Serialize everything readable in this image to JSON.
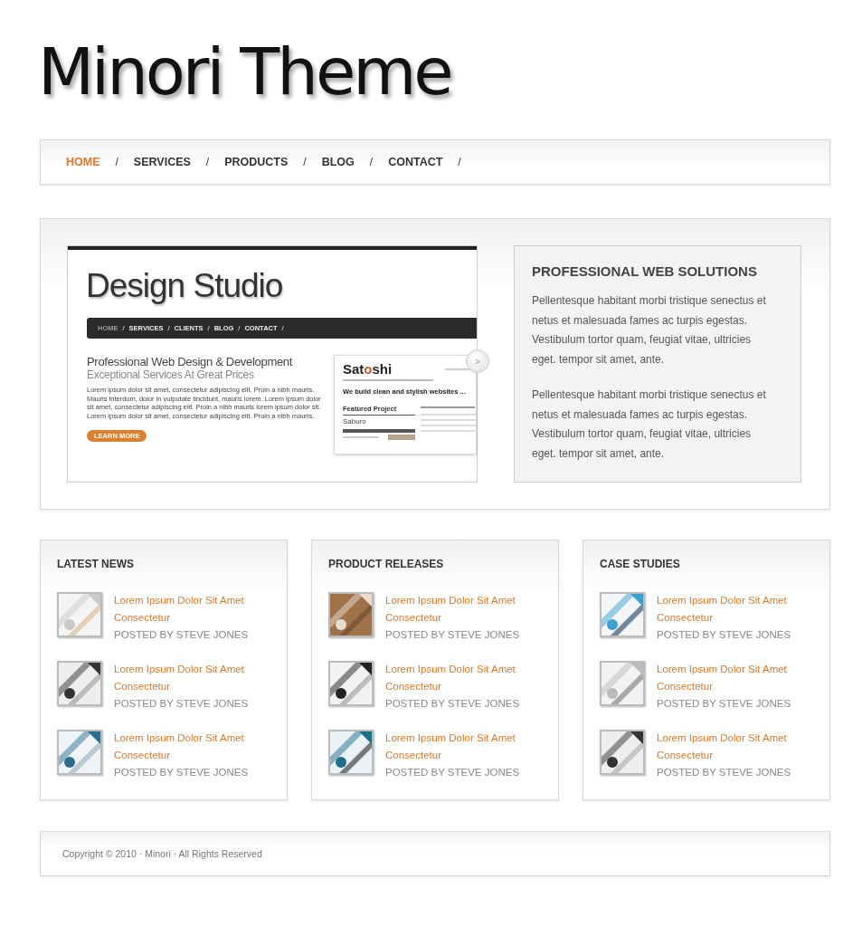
{
  "site_title": "Minori Theme",
  "nav": [
    {
      "label": "HOME",
      "selected": true,
      "separator": "/"
    },
    {
      "label": "SERVICES",
      "selected": false,
      "separator": "/"
    },
    {
      "label": "PRODUCTS",
      "selected": false,
      "separator": "/"
    },
    {
      "label": "BLOG",
      "selected": false,
      "separator": "/"
    },
    {
      "label": "CONTACT",
      "selected": false,
      "separator": "/"
    }
  ],
  "slider": {
    "slide": {
      "title": "Design Studio",
      "nav": [
        {
          "label": "HOME",
          "selected": true,
          "separator": "/"
        },
        {
          "label": "SERVICES",
          "selected": false,
          "separator": "/"
        },
        {
          "label": "CLIENTS",
          "selected": false,
          "separator": "/"
        },
        {
          "label": "BLOG",
          "selected": false,
          "separator": "/"
        },
        {
          "label": "CONTACT",
          "selected": false,
          "separator": "/"
        }
      ],
      "heading": "Professional Web Design & Development",
      "subheading": "Exceptional Services At Great Prices",
      "body": "Lorem ipsum dolor sit amet, consectetur adipiscing elit. Proin a nibh mauris. Mauris interdum, dolor in vulputate tincidunt, mauris lorem. Lorem ipsum dolor sit amet, consectetur adipiscing elit. Proin a nibh mauris lorem ipsum dolor sit. Lorem ipsum dolor sit amet, consectetur adipiscing elit. Proin a nibh mauris.",
      "button": "LEARN MORE",
      "preview": {
        "logo_start": "Sat",
        "logo_accent": "o",
        "logo_end": "shi",
        "tagline": "We build clean and stylish websites ...",
        "section": "Featured Project",
        "project": "Saburo"
      }
    },
    "next_button": ">",
    "panel": {
      "title": "PROFESSIONAL WEB SOLUTIONS",
      "paragraphs": [
        "Pellentesque habitant morbi tristique senectus et netus et malesuada fames ac turpis egestas. Vestibulum tortor quam, feugiat vitae, ultricies eget. tempor sit amet, ante.",
        "Pellentesque habitant morbi tristique senectus et netus et malesuada fames ac turpis egestas. Vestibulum tortor quam, feugiat vitae, ultricies eget. tempor sit amet, ante."
      ]
    }
  },
  "columns": [
    {
      "title": "LATEST NEWS",
      "posts": [
        {
          "title": "Lorem Ipsum Dolor Sit Amet Consectetur",
          "byline": "POSTED BY STEVE JONES"
        },
        {
          "title": "Lorem Ipsum Dolor Sit Amet Consectetur",
          "byline": "POSTED BY STEVE JONES"
        },
        {
          "title": "Lorem Ipsum Dolor Sit Amet Consectetur",
          "byline": "POSTED BY STEVE JONES"
        }
      ]
    },
    {
      "title": "PRODUCT RELEASES",
      "posts": [
        {
          "title": "Lorem Ipsum Dolor Sit Amet Consectetur",
          "byline": "POSTED BY STEVE JONES"
        },
        {
          "title": "Lorem Ipsum Dolor Sit Amet Consectetur",
          "byline": "POSTED BY STEVE JONES"
        },
        {
          "title": "Lorem Ipsum Dolor Sit Amet Consectetur",
          "byline": "POSTED BY STEVE JONES"
        }
      ]
    },
    {
      "title": "CASE STUDIES",
      "posts": [
        {
          "title": "Lorem Ipsum Dolor Sit Amet Consectetur",
          "byline": "POSTED BY STEVE JONES"
        },
        {
          "title": "Lorem Ipsum Dolor Sit Amet Consectetur",
          "byline": "POSTED BY STEVE JONES"
        },
        {
          "title": "Lorem Ipsum Dolor Sit Amet Consectetur",
          "byline": "POSTED BY STEVE JONES"
        }
      ]
    }
  ],
  "footer": "Copyright © 2010 · Minori · All Rights Reserved"
}
